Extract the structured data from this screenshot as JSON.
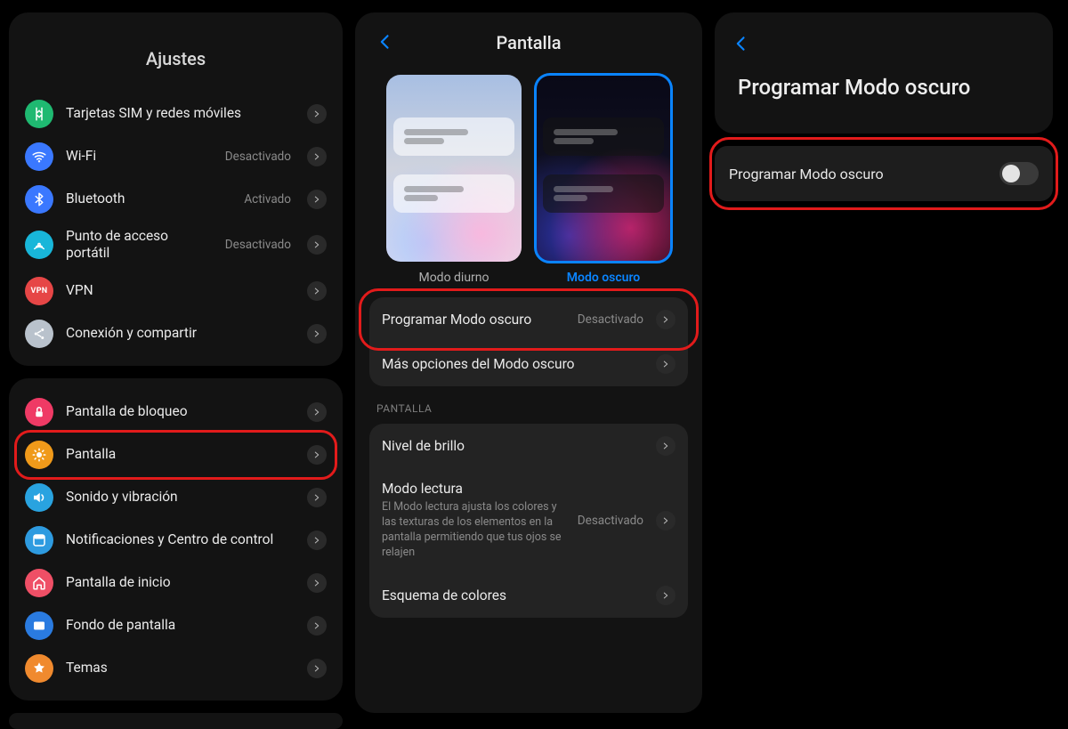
{
  "col1": {
    "title": "Ajustes",
    "groupA": [
      {
        "id": "sim",
        "label": "Tarjetas SIM y redes móviles",
        "status": "",
        "color": "#1fb971"
      },
      {
        "id": "wifi",
        "label": "Wi-Fi",
        "status": "Desactivado",
        "color": "#3a78ff"
      },
      {
        "id": "bluetooth",
        "label": "Bluetooth",
        "status": "Activado",
        "color": "#3a78ff"
      },
      {
        "id": "hotspot",
        "label": "Punto de acceso portátil",
        "status": "Desactivado",
        "color": "#18b6d9"
      },
      {
        "id": "vpn",
        "label": "VPN",
        "status": "",
        "color": "#e64646",
        "badge": "VPN"
      },
      {
        "id": "share",
        "label": "Conexión y compartir",
        "status": "",
        "color": "#b9c2cc"
      }
    ],
    "groupB": [
      {
        "id": "lockscreen",
        "label": "Pantalla de bloqueo",
        "color": "#ef3a65"
      },
      {
        "id": "display",
        "label": "Pantalla",
        "color": "#f09a1a",
        "highlighted": true
      },
      {
        "id": "sound",
        "label": "Sonido y vibración",
        "color": "#29a3e0"
      },
      {
        "id": "notif",
        "label": "Notificaciones y Centro de control",
        "color": "#2e9be0"
      },
      {
        "id": "home",
        "label": "Pantalla de inicio",
        "color": "#ef4f66"
      },
      {
        "id": "wallpaper",
        "label": "Fondo de pantalla",
        "color": "#2a7be0"
      },
      {
        "id": "themes",
        "label": "Temas",
        "color": "#f08a2e"
      }
    ]
  },
  "col2": {
    "header": "Pantalla",
    "tiles": {
      "light": "Modo diurno",
      "dark": "Modo oscuro"
    },
    "darkOptions": [
      {
        "id": "schedule",
        "label": "Programar Modo oscuro",
        "status": "Desactivado",
        "highlighted": true
      },
      {
        "id": "more",
        "label": "Más opciones del Modo oscuro",
        "status": ""
      }
    ],
    "section": "PANTALLA",
    "screenOptions": [
      {
        "id": "brightness",
        "label": "Nivel de brillo",
        "sub": "",
        "status": ""
      },
      {
        "id": "reading",
        "label": "Modo lectura",
        "sub": "El Modo lectura ajusta los colores y las texturas de los elementos en la pantalla permitiendo que tus ojos se relajen",
        "status": "Desactivado"
      },
      {
        "id": "scheme",
        "label": "Esquema de colores",
        "sub": "",
        "status": ""
      }
    ]
  },
  "col3": {
    "title": "Programar Modo oscuro",
    "row": {
      "label": "Programar Modo oscuro",
      "on": false,
      "highlighted": true
    }
  }
}
